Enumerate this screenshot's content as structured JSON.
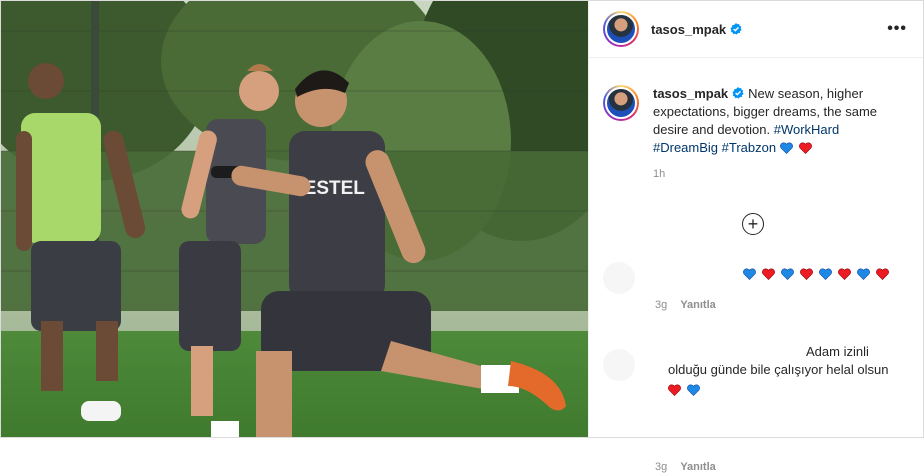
{
  "post": {
    "photo": {
      "jersey_text": "VESTEL"
    },
    "header": {
      "username": "tasos_mpak",
      "verified_icon": "verified-badge-icon",
      "more_icon": "more-options-icon",
      "more_label": "•••"
    },
    "caption": {
      "username": "tasos_mpak",
      "text": "New season, higher expectations, bigger dreams, the same desire and devotion.",
      "hashtags": [
        "#WorkHard",
        "#DreamBig",
        "#Trabzon"
      ],
      "emoji": [
        "blue-heart",
        "red-heart"
      ],
      "time": "1h"
    },
    "load_more": {
      "icon": "plus-circle-icon",
      "label": "+"
    },
    "comments": [
      {
        "hearts": [
          "blue",
          "red",
          "blue",
          "red",
          "blue",
          "red",
          "blue",
          "red"
        ],
        "age": "3g",
        "reply_label": "Yanıtla"
      },
      {
        "text_line1": "Adam izinli",
        "text_line2": "olduğu günde bile çalışıyor helal olsun",
        "hearts": [
          "red",
          "blue"
        ],
        "age": "3g",
        "reply_label": "Yanıtla"
      }
    ],
    "colors": {
      "hashtag": "#00376b",
      "verified": "#0095f6",
      "heart_red": "#ed1c24",
      "heart_blue": "#1e88e5",
      "trabzon_claret": "#6c1d2e"
    }
  }
}
